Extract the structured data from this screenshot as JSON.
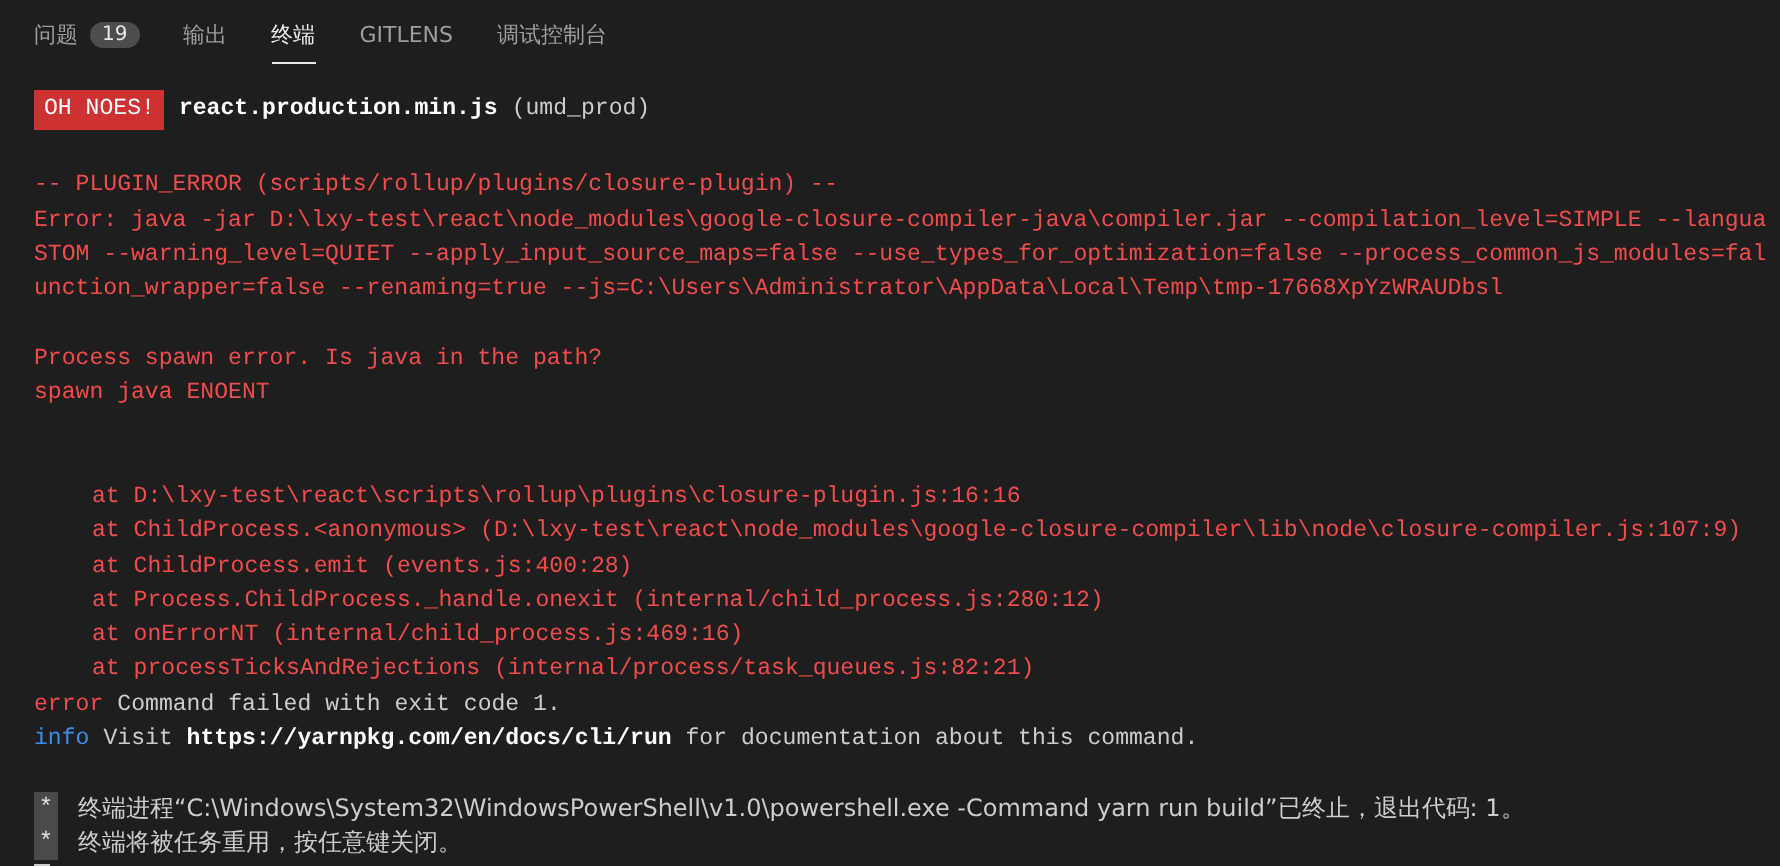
{
  "tabs": [
    {
      "label": "问题",
      "selected": false,
      "badge": "19"
    },
    {
      "label": "输出",
      "selected": false
    },
    {
      "label": "终端",
      "selected": true
    },
    {
      "label": "GITLENS",
      "selected": false
    },
    {
      "label": "调试控制台",
      "selected": false
    }
  ],
  "terminal": {
    "lines": [
      {
        "kind": "heading",
        "badge": "OH NOES!",
        "file": "react.production.min.js",
        "rest": "(umd_prod)"
      },
      {
        "kind": "blank"
      },
      {
        "kind": "error",
        "text": "-- PLUGIN_ERROR (scripts/rollup/plugins/closure-plugin) --"
      },
      {
        "kind": "error",
        "text": "Error: java -jar D:\\lxy-test\\react\\node_modules\\google-closure-compiler-java\\compiler.jar --compilation_level=SIMPLE --langua"
      },
      {
        "kind": "error",
        "text": "STOM --warning_level=QUIET --apply_input_source_maps=false --use_types_for_optimization=false --process_common_js_modules=fal"
      },
      {
        "kind": "error",
        "text": "unction_wrapper=false --renaming=true --js=C:\\Users\\Administrator\\AppData\\Local\\Temp\\tmp-17668XpYzWRAUDbsl"
      },
      {
        "kind": "blank"
      },
      {
        "kind": "error",
        "text": "Process spawn error. Is java in the path?"
      },
      {
        "kind": "error",
        "text": "spawn java ENOENT"
      },
      {
        "kind": "blank"
      },
      {
        "kind": "blank"
      },
      {
        "kind": "stack",
        "text": "at D:\\lxy-test\\react\\scripts\\rollup\\plugins\\closure-plugin.js:16:16"
      },
      {
        "kind": "stack",
        "text": "at ChildProcess.<anonymous> (D:\\lxy-test\\react\\node_modules\\google-closure-compiler\\lib\\node\\closure-compiler.js:107:9)"
      },
      {
        "kind": "stack",
        "text": "at ChildProcess.emit (events.js:400:28)"
      },
      {
        "kind": "stack",
        "text": "at Process.ChildProcess._handle.onexit (internal/child_process.js:280:12)"
      },
      {
        "kind": "stack",
        "text": "at onErrorNT (internal/child_process.js:469:16)"
      },
      {
        "kind": "stack",
        "text": "at processTicksAndRejections (internal/process/task_queues.js:82:21)"
      },
      {
        "kind": "status",
        "level": "error",
        "text": "Command failed with exit code 1."
      },
      {
        "kind": "status",
        "level": "info",
        "text": "Visit **https://yarnpkg.com/en/docs/cli/run** for documentation about this command."
      },
      {
        "kind": "blank"
      },
      {
        "kind": "note",
        "marker": "*",
        "text": "终端进程“C:\\Windows\\System32\\WindowsPowerShell\\v1.0\\powershell.exe -Command yarn run build”已终止，退出代码: 1。"
      },
      {
        "kind": "note",
        "marker": "*",
        "text": "终端将被任务重用，按任意键关闭。"
      },
      {
        "kind": "cursor"
      }
    ]
  }
}
